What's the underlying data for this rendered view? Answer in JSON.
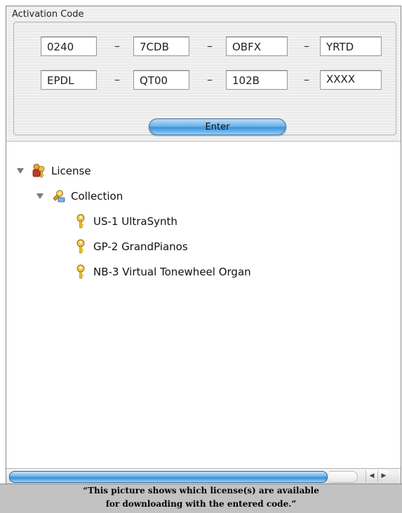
{
  "panel": {
    "title": "Activation Code",
    "fields_row1": [
      "0240",
      "7CDB",
      "OBFX",
      "YRTD"
    ],
    "fields_row2": [
      "EPDL",
      "QT00",
      "102B",
      "XXXX"
    ],
    "separator": "–",
    "enter_label": "Enter"
  },
  "tree": {
    "root": {
      "label": "License",
      "expanded": true,
      "icon": "license-people-key-icon"
    },
    "group": {
      "label": "Collection",
      "expanded": true,
      "icon": "collection-keys-icon"
    },
    "items": [
      {
        "label": "US-1 UltraSynth",
        "icon": "key-icon"
      },
      {
        "label": "GP-2 GrandPianos",
        "icon": "key-icon"
      },
      {
        "label": "NB-3 Virtual Tonewheel Organ",
        "icon": "key-icon"
      }
    ]
  },
  "caption": {
    "line1": "“This picture shows which license(s) are available",
    "line2": "for downloading with the entered code.”"
  },
  "colors": {
    "aqua_blue": "#3f92d9",
    "key_gold": "#e8b923",
    "caption_bg": "#c2c2c2"
  }
}
